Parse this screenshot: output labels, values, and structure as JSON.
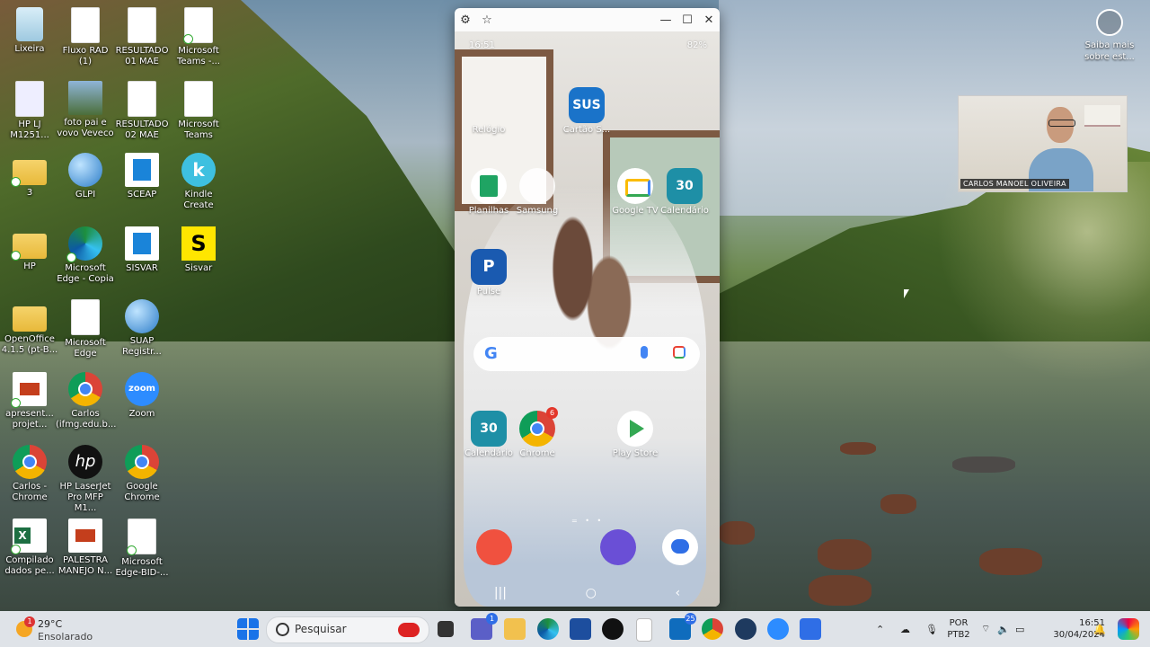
{
  "desktop": {
    "icons": [
      {
        "label": "Lixeira"
      },
      {
        "label": "Fluxo RAD (1)"
      },
      {
        "label": "RESULTADO 01 MAE"
      },
      {
        "label": "Microsoft Teams -..."
      },
      {
        "label": "HP LJ M1251..."
      },
      {
        "label": "foto pai e vovo Veveco"
      },
      {
        "label": "RESULTADO 02 MAE"
      },
      {
        "label": "Microsoft Teams"
      },
      {
        "label": "3"
      },
      {
        "label": "GLPI"
      },
      {
        "label": "SCEAP"
      },
      {
        "label": "Kindle Create"
      },
      {
        "label": "HP"
      },
      {
        "label": "Microsoft Edge - Copia"
      },
      {
        "label": "SISVAR"
      },
      {
        "label": "Sisvar"
      },
      {
        "label": "OpenOffice 4.1.5 (pt-B..."
      },
      {
        "label": "Microsoft Edge"
      },
      {
        "label": "SUAP Registr..."
      },
      {
        "label": "apresent... projet..."
      },
      {
        "label": "Carlos (ifmg.edu.b..."
      },
      {
        "label": "Zoom"
      },
      {
        "label": "Carlos - Chrome"
      },
      {
        "label": "HP LaserJet Pro MFP M1..."
      },
      {
        "label": "Google Chrome"
      },
      {
        "label": "Compilado dados pe..."
      },
      {
        "label": "PALESTRA MANEJO N..."
      },
      {
        "label": "Microsoft Edge-BID-..."
      }
    ],
    "icon_glyphs": {
      "zoom": "zoom",
      "kindle": "k",
      "sisvar": "S",
      "hp": "hp"
    }
  },
  "phone_window": {
    "toolbar_icons": [
      "gear-icon",
      "star-icon",
      "minimize-icon",
      "maximize-icon",
      "close-icon"
    ],
    "status": {
      "time": "16:51",
      "battery": "82%"
    },
    "apps_top": [
      {
        "label": "Relógio"
      },
      {
        "label": "Cartão S..."
      },
      {
        "label": "Planilhas"
      },
      {
        "label": "Samsung"
      },
      {
        "label": "Google TV"
      },
      {
        "label": "Calendário"
      },
      {
        "label": "Pulse"
      }
    ],
    "apps_dock_row": [
      {
        "label": "Calendário"
      },
      {
        "label": "Chrome",
        "badge": "6"
      },
      {
        "label": "Play Store"
      }
    ],
    "icon_text": {
      "sus": "SUS",
      "calendar_day": "30",
      "pulse": "P",
      "google": "G"
    },
    "nav": {
      "recents": "|||",
      "home": "○",
      "back": "‹"
    }
  },
  "webcam": {
    "name": "CARLOS MANOEL OLIVEIRA"
  },
  "saiba_mais": {
    "label": "Saiba mais sobre est..."
  },
  "taskbar": {
    "weather": {
      "temp": "29°C",
      "desc": "Ensolarado",
      "badge": "1"
    },
    "search_placeholder": "Pesquisar",
    "teams_badge": "1",
    "outlook_badge": "25",
    "language": {
      "line1": "POR",
      "line2": "PTB2"
    },
    "clock": {
      "time": "16:51",
      "date": "30/04/2024"
    }
  }
}
